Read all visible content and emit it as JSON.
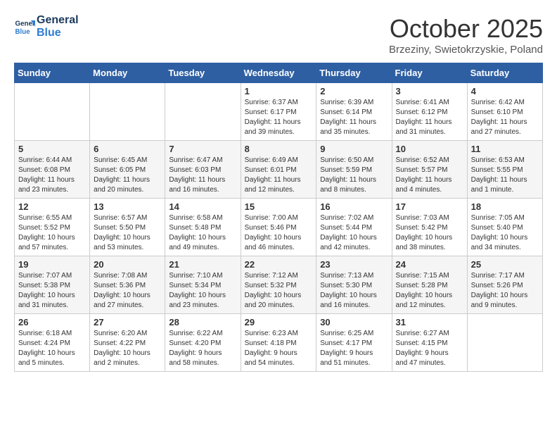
{
  "header": {
    "logo_line1": "General",
    "logo_line2": "Blue",
    "month_title": "October 2025",
    "location": "Brzeziny, Swietokrzyskie, Poland"
  },
  "days_of_week": [
    "Sunday",
    "Monday",
    "Tuesday",
    "Wednesday",
    "Thursday",
    "Friday",
    "Saturday"
  ],
  "weeks": [
    [
      {
        "day": "",
        "info": ""
      },
      {
        "day": "",
        "info": ""
      },
      {
        "day": "",
        "info": ""
      },
      {
        "day": "1",
        "info": "Sunrise: 6:37 AM\nSunset: 6:17 PM\nDaylight: 11 hours\nand 39 minutes."
      },
      {
        "day": "2",
        "info": "Sunrise: 6:39 AM\nSunset: 6:14 PM\nDaylight: 11 hours\nand 35 minutes."
      },
      {
        "day": "3",
        "info": "Sunrise: 6:41 AM\nSunset: 6:12 PM\nDaylight: 11 hours\nand 31 minutes."
      },
      {
        "day": "4",
        "info": "Sunrise: 6:42 AM\nSunset: 6:10 PM\nDaylight: 11 hours\nand 27 minutes."
      }
    ],
    [
      {
        "day": "5",
        "info": "Sunrise: 6:44 AM\nSunset: 6:08 PM\nDaylight: 11 hours\nand 23 minutes."
      },
      {
        "day": "6",
        "info": "Sunrise: 6:45 AM\nSunset: 6:05 PM\nDaylight: 11 hours\nand 20 minutes."
      },
      {
        "day": "7",
        "info": "Sunrise: 6:47 AM\nSunset: 6:03 PM\nDaylight: 11 hours\nand 16 minutes."
      },
      {
        "day": "8",
        "info": "Sunrise: 6:49 AM\nSunset: 6:01 PM\nDaylight: 11 hours\nand 12 minutes."
      },
      {
        "day": "9",
        "info": "Sunrise: 6:50 AM\nSunset: 5:59 PM\nDaylight: 11 hours\nand 8 minutes."
      },
      {
        "day": "10",
        "info": "Sunrise: 6:52 AM\nSunset: 5:57 PM\nDaylight: 11 hours\nand 4 minutes."
      },
      {
        "day": "11",
        "info": "Sunrise: 6:53 AM\nSunset: 5:55 PM\nDaylight: 11 hours\nand 1 minute."
      }
    ],
    [
      {
        "day": "12",
        "info": "Sunrise: 6:55 AM\nSunset: 5:52 PM\nDaylight: 10 hours\nand 57 minutes."
      },
      {
        "day": "13",
        "info": "Sunrise: 6:57 AM\nSunset: 5:50 PM\nDaylight: 10 hours\nand 53 minutes."
      },
      {
        "day": "14",
        "info": "Sunrise: 6:58 AM\nSunset: 5:48 PM\nDaylight: 10 hours\nand 49 minutes."
      },
      {
        "day": "15",
        "info": "Sunrise: 7:00 AM\nSunset: 5:46 PM\nDaylight: 10 hours\nand 46 minutes."
      },
      {
        "day": "16",
        "info": "Sunrise: 7:02 AM\nSunset: 5:44 PM\nDaylight: 10 hours\nand 42 minutes."
      },
      {
        "day": "17",
        "info": "Sunrise: 7:03 AM\nSunset: 5:42 PM\nDaylight: 10 hours\nand 38 minutes."
      },
      {
        "day": "18",
        "info": "Sunrise: 7:05 AM\nSunset: 5:40 PM\nDaylight: 10 hours\nand 34 minutes."
      }
    ],
    [
      {
        "day": "19",
        "info": "Sunrise: 7:07 AM\nSunset: 5:38 PM\nDaylight: 10 hours\nand 31 minutes."
      },
      {
        "day": "20",
        "info": "Sunrise: 7:08 AM\nSunset: 5:36 PM\nDaylight: 10 hours\nand 27 minutes."
      },
      {
        "day": "21",
        "info": "Sunrise: 7:10 AM\nSunset: 5:34 PM\nDaylight: 10 hours\nand 23 minutes."
      },
      {
        "day": "22",
        "info": "Sunrise: 7:12 AM\nSunset: 5:32 PM\nDaylight: 10 hours\nand 20 minutes."
      },
      {
        "day": "23",
        "info": "Sunrise: 7:13 AM\nSunset: 5:30 PM\nDaylight: 10 hours\nand 16 minutes."
      },
      {
        "day": "24",
        "info": "Sunrise: 7:15 AM\nSunset: 5:28 PM\nDaylight: 10 hours\nand 12 minutes."
      },
      {
        "day": "25",
        "info": "Sunrise: 7:17 AM\nSunset: 5:26 PM\nDaylight: 10 hours\nand 9 minutes."
      }
    ],
    [
      {
        "day": "26",
        "info": "Sunrise: 6:18 AM\nSunset: 4:24 PM\nDaylight: 10 hours\nand 5 minutes."
      },
      {
        "day": "27",
        "info": "Sunrise: 6:20 AM\nSunset: 4:22 PM\nDaylight: 10 hours\nand 2 minutes."
      },
      {
        "day": "28",
        "info": "Sunrise: 6:22 AM\nSunset: 4:20 PM\nDaylight: 9 hours\nand 58 minutes."
      },
      {
        "day": "29",
        "info": "Sunrise: 6:23 AM\nSunset: 4:18 PM\nDaylight: 9 hours\nand 54 minutes."
      },
      {
        "day": "30",
        "info": "Sunrise: 6:25 AM\nSunset: 4:17 PM\nDaylight: 9 hours\nand 51 minutes."
      },
      {
        "day": "31",
        "info": "Sunrise: 6:27 AM\nSunset: 4:15 PM\nDaylight: 9 hours\nand 47 minutes."
      },
      {
        "day": "",
        "info": ""
      }
    ]
  ]
}
